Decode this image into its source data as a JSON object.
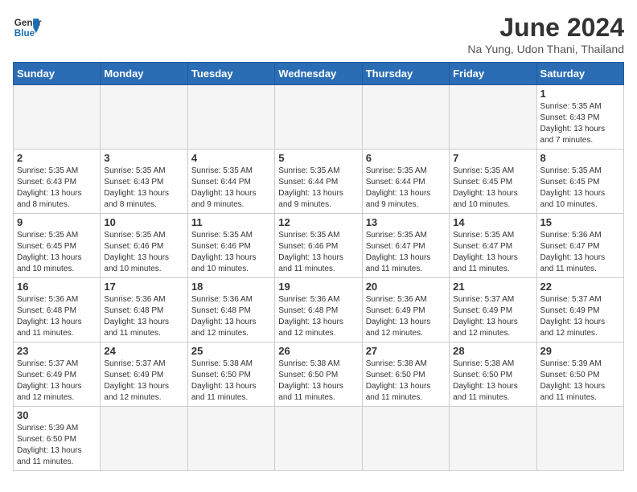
{
  "header": {
    "logo_general": "General",
    "logo_blue": "Blue",
    "title": "June 2024",
    "subtitle": "Na Yung, Udon Thani, Thailand"
  },
  "weekdays": [
    "Sunday",
    "Monday",
    "Tuesday",
    "Wednesday",
    "Thursday",
    "Friday",
    "Saturday"
  ],
  "weeks": [
    [
      {
        "day": "",
        "info": ""
      },
      {
        "day": "",
        "info": ""
      },
      {
        "day": "",
        "info": ""
      },
      {
        "day": "",
        "info": ""
      },
      {
        "day": "",
        "info": ""
      },
      {
        "day": "",
        "info": ""
      },
      {
        "day": "1",
        "info": "Sunrise: 5:35 AM\nSunset: 6:43 PM\nDaylight: 13 hours and 7 minutes."
      }
    ],
    [
      {
        "day": "2",
        "info": "Sunrise: 5:35 AM\nSunset: 6:43 PM\nDaylight: 13 hours and 8 minutes."
      },
      {
        "day": "3",
        "info": "Sunrise: 5:35 AM\nSunset: 6:43 PM\nDaylight: 13 hours and 8 minutes."
      },
      {
        "day": "4",
        "info": "Sunrise: 5:35 AM\nSunset: 6:44 PM\nDaylight: 13 hours and 9 minutes."
      },
      {
        "day": "5",
        "info": "Sunrise: 5:35 AM\nSunset: 6:44 PM\nDaylight: 13 hours and 9 minutes."
      },
      {
        "day": "6",
        "info": "Sunrise: 5:35 AM\nSunset: 6:44 PM\nDaylight: 13 hours and 9 minutes."
      },
      {
        "day": "7",
        "info": "Sunrise: 5:35 AM\nSunset: 6:45 PM\nDaylight: 13 hours and 10 minutes."
      },
      {
        "day": "8",
        "info": "Sunrise: 5:35 AM\nSunset: 6:45 PM\nDaylight: 13 hours and 10 minutes."
      }
    ],
    [
      {
        "day": "9",
        "info": "Sunrise: 5:35 AM\nSunset: 6:45 PM\nDaylight: 13 hours and 10 minutes."
      },
      {
        "day": "10",
        "info": "Sunrise: 5:35 AM\nSunset: 6:46 PM\nDaylight: 13 hours and 10 minutes."
      },
      {
        "day": "11",
        "info": "Sunrise: 5:35 AM\nSunset: 6:46 PM\nDaylight: 13 hours and 10 minutes."
      },
      {
        "day": "12",
        "info": "Sunrise: 5:35 AM\nSunset: 6:46 PM\nDaylight: 13 hours and 11 minutes."
      },
      {
        "day": "13",
        "info": "Sunrise: 5:35 AM\nSunset: 6:47 PM\nDaylight: 13 hours and 11 minutes."
      },
      {
        "day": "14",
        "info": "Sunrise: 5:35 AM\nSunset: 6:47 PM\nDaylight: 13 hours and 11 minutes."
      },
      {
        "day": "15",
        "info": "Sunrise: 5:36 AM\nSunset: 6:47 PM\nDaylight: 13 hours and 11 minutes."
      }
    ],
    [
      {
        "day": "16",
        "info": "Sunrise: 5:36 AM\nSunset: 6:48 PM\nDaylight: 13 hours and 11 minutes."
      },
      {
        "day": "17",
        "info": "Sunrise: 5:36 AM\nSunset: 6:48 PM\nDaylight: 13 hours and 11 minutes."
      },
      {
        "day": "18",
        "info": "Sunrise: 5:36 AM\nSunset: 6:48 PM\nDaylight: 13 hours and 12 minutes."
      },
      {
        "day": "19",
        "info": "Sunrise: 5:36 AM\nSunset: 6:48 PM\nDaylight: 13 hours and 12 minutes."
      },
      {
        "day": "20",
        "info": "Sunrise: 5:36 AM\nSunset: 6:49 PM\nDaylight: 13 hours and 12 minutes."
      },
      {
        "day": "21",
        "info": "Sunrise: 5:37 AM\nSunset: 6:49 PM\nDaylight: 13 hours and 12 minutes."
      },
      {
        "day": "22",
        "info": "Sunrise: 5:37 AM\nSunset: 6:49 PM\nDaylight: 13 hours and 12 minutes."
      }
    ],
    [
      {
        "day": "23",
        "info": "Sunrise: 5:37 AM\nSunset: 6:49 PM\nDaylight: 13 hours and 12 minutes."
      },
      {
        "day": "24",
        "info": "Sunrise: 5:37 AM\nSunset: 6:49 PM\nDaylight: 13 hours and 12 minutes."
      },
      {
        "day": "25",
        "info": "Sunrise: 5:38 AM\nSunset: 6:50 PM\nDaylight: 13 hours and 11 minutes."
      },
      {
        "day": "26",
        "info": "Sunrise: 5:38 AM\nSunset: 6:50 PM\nDaylight: 13 hours and 11 minutes."
      },
      {
        "day": "27",
        "info": "Sunrise: 5:38 AM\nSunset: 6:50 PM\nDaylight: 13 hours and 11 minutes."
      },
      {
        "day": "28",
        "info": "Sunrise: 5:38 AM\nSunset: 6:50 PM\nDaylight: 13 hours and 11 minutes."
      },
      {
        "day": "29",
        "info": "Sunrise: 5:39 AM\nSunset: 6:50 PM\nDaylight: 13 hours and 11 minutes."
      }
    ],
    [
      {
        "day": "30",
        "info": "Sunrise: 5:39 AM\nSunset: 6:50 PM\nDaylight: 13 hours and 11 minutes."
      },
      {
        "day": "",
        "info": ""
      },
      {
        "day": "",
        "info": ""
      },
      {
        "day": "",
        "info": ""
      },
      {
        "day": "",
        "info": ""
      },
      {
        "day": "",
        "info": ""
      },
      {
        "day": "",
        "info": ""
      }
    ]
  ]
}
